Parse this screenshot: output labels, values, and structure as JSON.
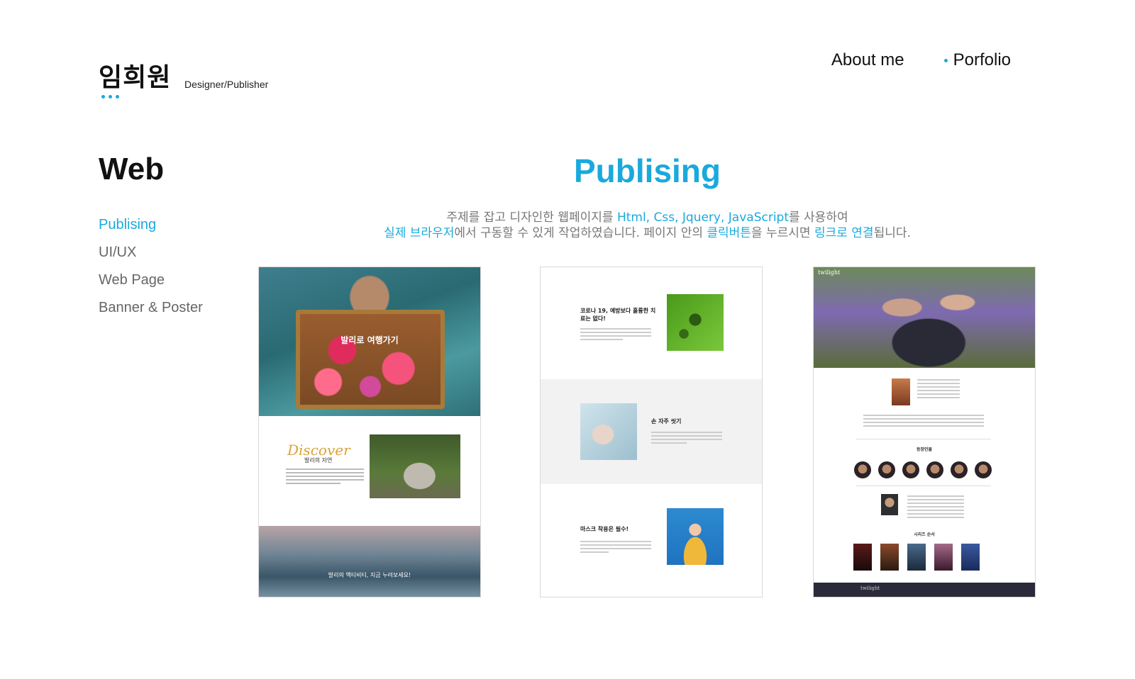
{
  "header": {
    "name": "임희원",
    "role": "Designer/Publisher",
    "nav": [
      {
        "label": "About me",
        "active": false
      },
      {
        "label": "Porfolio",
        "active": true
      }
    ]
  },
  "sidebar": {
    "title": "Web",
    "items": [
      {
        "label": "Publising",
        "active": true
      },
      {
        "label": "UI/UX",
        "active": false
      },
      {
        "label": "Web Page",
        "active": false
      },
      {
        "label": "Banner & Poster",
        "active": false
      }
    ]
  },
  "main": {
    "heading": "Publising",
    "desc": {
      "l1_a": "주제를 잡고 디자인한 웹페이지를 ",
      "l1_hl": "Html, Css, Jquery, JavaScript",
      "l1_b": "를 사용하여",
      "l2_hl1": "실제 브라우저",
      "l2_a": "에서 구동할 수 있게 작업하였습니다. 페이지 안의 ",
      "l2_hl2": "클릭버튼",
      "l2_b": "을 누르시면 ",
      "l2_hl3": "링크로 연결",
      "l2_c": "됩니다."
    },
    "cards": [
      {
        "hero_text": "발리로 여행가기",
        "discover": "Discover",
        "discover_sub": "발리의 자연",
        "bottom_text": "발리의 액티비티, 지금 누려보세요!"
      },
      {
        "s1_title": "코로나 19, 예방보다 훌륭한 치료는 없다!",
        "s2_title": "손 자주 씻기",
        "s3_title": "마스크 착용은 필수!"
      },
      {
        "logo": "twilight",
        "cast_title": "등장인물",
        "series_title": "시리즈 순서",
        "footer_logo": "twilight"
      }
    ]
  },
  "colors": {
    "accent": "#1aa9dd",
    "muted_text": "#777777"
  }
}
